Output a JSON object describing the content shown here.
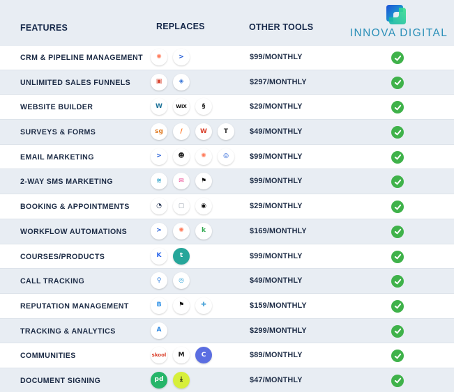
{
  "header": {
    "features": "FEATURES",
    "replaces": "REPLACES",
    "other_tools": "OTHER TOOLS",
    "brand": "INNOVA DIGITAL"
  },
  "colors": {
    "header_bg": "#e8edf3",
    "alt_row_bg": "#e8edf3",
    "text": "#1c2b45",
    "check": "#3fb24a",
    "brand": "#2a8fb8"
  },
  "rows": [
    {
      "feature": "CRM & PIPELINE MANAGEMENT",
      "price": "$99/MONTHLY",
      "tools": [
        {
          "name": "hubspot-icon",
          "glyph": "✺",
          "color": "#ff7a59"
        },
        {
          "name": "activecampaign-icon",
          "glyph": ">",
          "color": "#1f5ad6"
        }
      ]
    },
    {
      "feature": "UNLIMITED SALES FUNNELS",
      "price": "$297/MONTHLY",
      "tools": [
        {
          "name": "clickfunnels-icon",
          "glyph": "▣",
          "color": "#d94a36"
        },
        {
          "name": "kartra-icon",
          "glyph": "◈",
          "color": "#2f6fd6"
        }
      ]
    },
    {
      "feature": "WEBSITE BUILDER",
      "price": "$29/MONTHLY",
      "tools": [
        {
          "name": "wordpress-icon",
          "glyph": "W",
          "color": "#21759b"
        },
        {
          "name": "wix-icon",
          "glyph": "WiX",
          "color": "#111111"
        },
        {
          "name": "squarespace-icon",
          "glyph": "§",
          "color": "#111111"
        }
      ]
    },
    {
      "feature": "SURVEYS & FORMS",
      "price": "$49/MONTHLY",
      "tools": [
        {
          "name": "surveygizmo-icon",
          "glyph": "sg",
          "color": "#e07b22"
        },
        {
          "name": "jotform-icon",
          "glyph": "/",
          "color": "#ff6100"
        },
        {
          "name": "wufoo-icon",
          "glyph": "W",
          "color": "#d9402b"
        },
        {
          "name": "typeform-icon",
          "glyph": "T",
          "color": "#333333"
        }
      ]
    },
    {
      "feature": "EMAIL MARKETING",
      "price": "$99/MONTHLY",
      "tools": [
        {
          "name": "activecampaign-icon",
          "glyph": ">",
          "color": "#1f5ad6"
        },
        {
          "name": "mailchimp-icon",
          "glyph": "☻",
          "color": "#222222"
        },
        {
          "name": "hubspot-icon",
          "glyph": "✺",
          "color": "#ff7a59"
        },
        {
          "name": "constantcontact-icon",
          "glyph": "◎",
          "color": "#1856d4"
        }
      ]
    },
    {
      "feature": "2-WAY SMS MARKETING",
      "price": "$99/MONTHLY",
      "tools": [
        {
          "name": "stacked-chevrons-icon",
          "glyph": "≋",
          "color": "#2aa0c9"
        },
        {
          "name": "mail-envelope-icon",
          "glyph": "✉",
          "color": "#e8418f"
        },
        {
          "name": "flag-icon",
          "glyph": "⚑",
          "color": "#111111"
        }
      ]
    },
    {
      "feature": "BOOKING & APPOINTMENTS",
      "price": "$29/MONTHLY",
      "tools": [
        {
          "name": "calendly-icon",
          "glyph": "◔",
          "color": "#1a2a4a"
        },
        {
          "name": "calendar-icon",
          "glyph": "▢",
          "color": "#9aa3ad"
        },
        {
          "name": "acuity-icon",
          "glyph": "◉",
          "color": "#111111"
        }
      ]
    },
    {
      "feature": "WORKFLOW AUTOMATIONS",
      "price": "$169/MONTHLY",
      "tools": [
        {
          "name": "activecampaign-icon",
          "glyph": ">",
          "color": "#1f5ad6"
        },
        {
          "name": "hubspot-icon",
          "glyph": "✺",
          "color": "#ff7a59"
        },
        {
          "name": "keap-icon",
          "glyph": "k",
          "color": "#2fa84f"
        }
      ]
    },
    {
      "feature": "COURSES/PRODUCTS",
      "price": "$99/MONTHLY",
      "tools": [
        {
          "name": "kajabi-icon",
          "glyph": "K",
          "color": "#2563eb"
        },
        {
          "name": "teachable-icon",
          "glyph": "t",
          "color": "#ffffff",
          "bg": "#26a69a"
        }
      ]
    },
    {
      "feature": "CALL TRACKING",
      "price": "$49/MONTHLY",
      "tools": [
        {
          "name": "location-pin-icon",
          "glyph": "⚲",
          "color": "#2b7de0"
        },
        {
          "name": "callrail-icon",
          "glyph": "◎",
          "color": "#2a9fd6"
        }
      ]
    },
    {
      "feature": "REPUTATION MANAGEMENT",
      "price": "$159/MONTHLY",
      "tools": [
        {
          "name": "birdeye-icon",
          "glyph": "B",
          "color": "#1e88e5"
        },
        {
          "name": "flag-icon",
          "glyph": "⚑",
          "color": "#111111"
        },
        {
          "name": "puzzle-icon",
          "glyph": "✚",
          "color": "#4aa3d8"
        }
      ]
    },
    {
      "feature": "TRACKING & ANALYTICS",
      "price": "$299/MONTHLY",
      "tools": [
        {
          "name": "analytics-icon",
          "glyph": "A",
          "color": "#2a86e0"
        }
      ]
    },
    {
      "feature": "COMMUNITIES",
      "price": "$89/MONTHLY",
      "tools": [
        {
          "name": "skool-icon",
          "glyph": "skool",
          "color": "#d9402b"
        },
        {
          "name": "mighty-networks-icon",
          "glyph": "M",
          "color": "#111111"
        },
        {
          "name": "circle-icon",
          "glyph": "C",
          "color": "#ffffff",
          "bg": "#5b6ee1"
        }
      ]
    },
    {
      "feature": "DOCUMENT SIGNING",
      "price": "$47/MONTHLY",
      "tools": [
        {
          "name": "pandadoc-icon",
          "glyph": "pd",
          "color": "#ffffff",
          "bg": "#26b569"
        },
        {
          "name": "download-icon",
          "glyph": "⤓",
          "color": "#111111",
          "bg": "#d7ef3a"
        }
      ]
    }
  ]
}
